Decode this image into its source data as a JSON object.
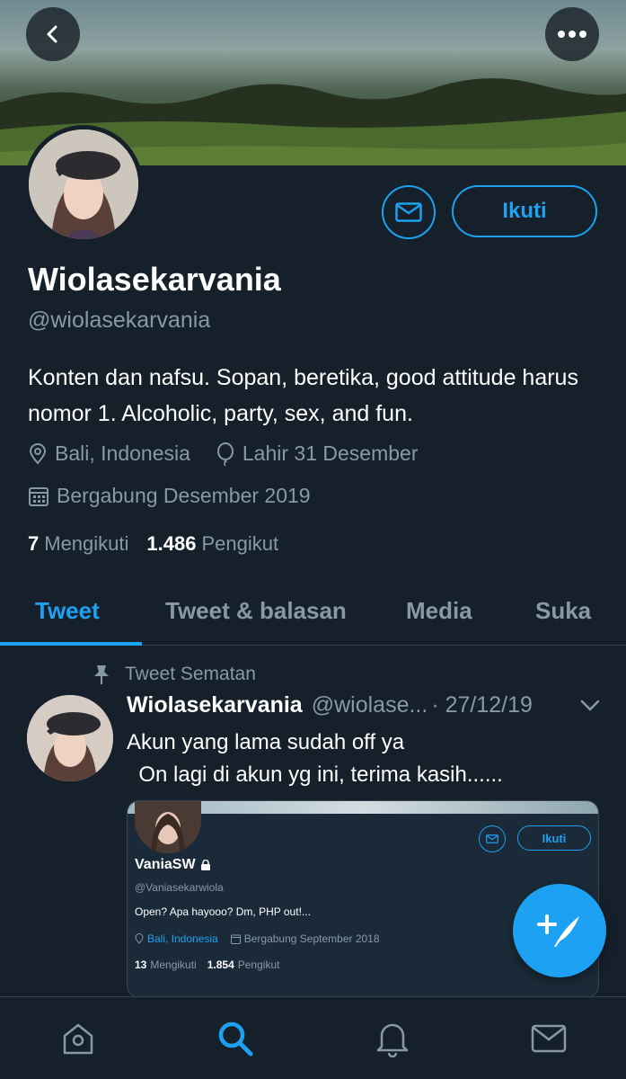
{
  "profile": {
    "name": "Wiolasekarvania",
    "handle": "@wiolasekarvania",
    "bio": "Konten dan nafsu. Sopan, beretika, good attitude harus nomor 1. Alcoholic, party, sex, and fun.",
    "location": "Bali, Indonesia",
    "birthday": "Lahir 31 Desember",
    "joined": "Bergabung Desember 2019",
    "following_count": "7",
    "following_label": "Mengikuti",
    "followers_count": "1.486",
    "followers_label": "Pengikut",
    "follow_label": "Ikuti"
  },
  "tabs": [
    {
      "label": "Tweet",
      "active": true
    },
    {
      "label": "Tweet & balasan",
      "active": false
    },
    {
      "label": "Media",
      "active": false
    },
    {
      "label": "Suka",
      "active": false
    }
  ],
  "pinned_tweet": {
    "pinned_label": "Tweet Sematan",
    "author_name": "Wiolasekarvania",
    "author_handle": "@wiolase...",
    "date": "· 27/12/19",
    "text": "Akun yang lama sudah off ya\n  On lagi di akun yg ini, terima kasih......",
    "embed": {
      "name": "VaniaSW",
      "handle": "@Vaniasekarwiola",
      "bio": "Open? Apa hayooo? Dm, PHP out!...",
      "location": "Bali, Indonesia",
      "joined": "Bergabung September 2018",
      "following_count": "13",
      "following_label": "Mengikuti",
      "followers_count": "1.854",
      "followers_label": "Pengikut",
      "follow_label": "Ikuti"
    }
  },
  "icons": {
    "back": "back-arrow-icon",
    "more": "more-icon",
    "message": "mail-icon",
    "location": "location-pin-icon",
    "birthday": "balloon-icon",
    "calendar": "calendar-icon",
    "pin": "pin-icon",
    "chevron": "chevron-down-icon",
    "compose": "compose-icon",
    "home": "home-icon",
    "search": "search-icon",
    "notifications": "bell-icon",
    "messages": "mail-icon"
  },
  "colors": {
    "background": "#15202b",
    "accent": "#1da1f2",
    "secondary_text": "#8899a6",
    "divider": "#38444d"
  }
}
